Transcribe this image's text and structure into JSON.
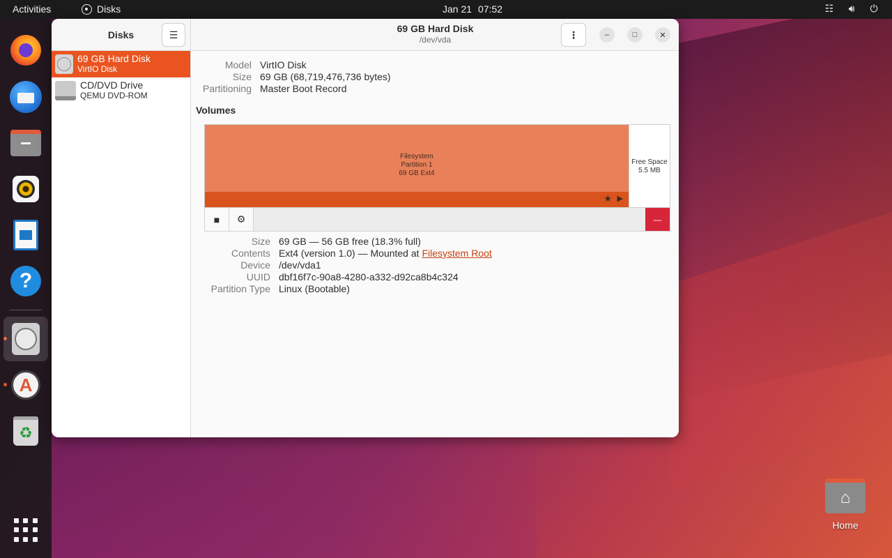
{
  "topbar": {
    "activities": "Activities",
    "app_name": "Disks",
    "date": "Jan 21",
    "time": "07:52",
    "tray_icons": [
      "network-icon",
      "volume-icon",
      "power-icon"
    ]
  },
  "dock": {
    "apps": [
      "Firefox",
      "Thunderbird",
      "Files",
      "Rhythmbox",
      "LibreOffice Writer",
      "Help",
      "Disks",
      "Software",
      "Trash",
      "Show Applications"
    ]
  },
  "desktop": {
    "home_label": "Home"
  },
  "sidebar": {
    "title": "Disks",
    "drives": [
      {
        "name": "69 GB Hard Disk",
        "subtitle": "VirtIO Disk",
        "selected": true
      },
      {
        "name": "CD/DVD Drive",
        "subtitle": "QEMU DVD-ROM",
        "selected": false
      }
    ]
  },
  "header": {
    "title": "69 GB Hard Disk",
    "subtitle": "/dev/vda"
  },
  "disk_info": {
    "model_label": "Model",
    "model_value": "VirtIO Disk",
    "size_label": "Size",
    "size_value": "69 GB (68,719,476,736 bytes)",
    "partitioning_label": "Partitioning",
    "partitioning_value": "Master Boot Record"
  },
  "volumes": {
    "label": "Volumes",
    "partition": {
      "line1": "Filesystem",
      "line2": "Partition 1",
      "line3": "69 GB Ext4"
    },
    "free_space": {
      "line1": "Free Space",
      "line2": "5.5 MB"
    },
    "details": {
      "size_label": "Size",
      "size_value": "69 GB — 56 GB free (18.3% full)",
      "contents_label": "Contents",
      "contents_prefix": "Ext4 (version 1.0) — Mounted at ",
      "contents_link": "Filesystem Root",
      "device_label": "Device",
      "device_value": "/dev/vda1",
      "uuid_label": "UUID",
      "uuid_value": "dbf16f7c-90a8-4280-a332-d92ca8b4c324",
      "ptype_label": "Partition Type",
      "ptype_value": "Linux (Bootable)"
    }
  },
  "colors": {
    "accent": "#e95420",
    "partition": "#e8815a",
    "partition_bar": "#d9531c",
    "delete": "#d7263a"
  }
}
